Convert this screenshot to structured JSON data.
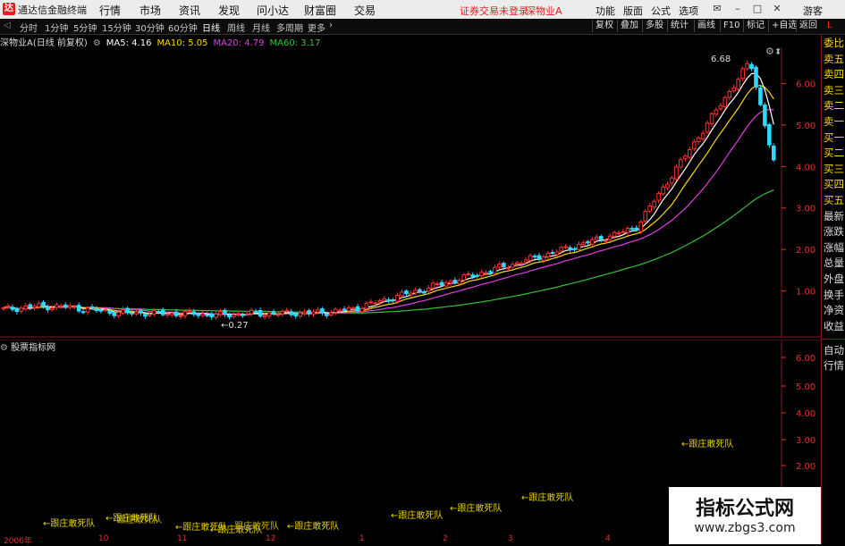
{
  "titlebar": {
    "app_name": "通达信金融终端",
    "menus": [
      "行情",
      "市场",
      "资讯",
      "发现",
      "问小达",
      "财富圈",
      "交易"
    ],
    "notice": "证券交易未登录",
    "stock_name": "深物业A",
    "right_menus": [
      "功能",
      "版面",
      "公式",
      "选项"
    ],
    "user": "游客"
  },
  "toolbar": {
    "periods": [
      "分时",
      "1分钟",
      "5分钟",
      "15分钟",
      "30分钟",
      "60分钟",
      "日线",
      "周线",
      "月线",
      "多周期",
      "更多"
    ],
    "active_period": "日线",
    "right_buttons": [
      "复权",
      "叠加",
      "多股",
      "统计",
      "画线",
      "F10",
      "标记",
      "+自选",
      "返回"
    ]
  },
  "chart_info": {
    "title": "深物业A(日线 前复权)",
    "ma5": "MA5: 4.16",
    "ma10": "MA10: 5.05",
    "ma20": "MA20: 4.79",
    "ma60": "MA60: 3.17",
    "colors": {
      "ma5": "#ffffff",
      "ma10": "#ffd800",
      "ma20": "#e040e0",
      "ma60": "#35c235",
      "up": "#ff3030",
      "down": "#30d8ff"
    }
  },
  "main_chart": {
    "price_labels": [
      "6.00",
      "5.00",
      "4.00",
      "3.00",
      "2.00",
      "1.00"
    ],
    "high_label": "6.68",
    "low_label": "0.27",
    "ylim": [
      0,
      7
    ],
    "indicator_name": "L"
  },
  "right_panel": {
    "items": [
      "委比",
      "卖五",
      "卖四",
      "卖三",
      "卖二",
      "卖一",
      "买一",
      "买二",
      "买三",
      "买四",
      "买五",
      "最新",
      "涨跌",
      "涨幅",
      "总量",
      "外盘",
      "换手",
      "净资",
      "收益"
    ],
    "bottom_items": [
      "自动",
      "行情"
    ]
  },
  "lower_chart": {
    "title": "股票指标网",
    "price_labels": [
      "6.00",
      "5.00",
      "4.00",
      "3.00",
      "2.00"
    ],
    "signal_text": "←跟庄敢死队",
    "signal_text2": "←跟庄敢死队",
    "overlap_text": "跟庄敢死队"
  },
  "x_axis": {
    "labels": [
      "2006年",
      "10",
      "11",
      "12",
      "1",
      "2",
      "3",
      "4"
    ]
  },
  "watermark": {
    "line1": "指标公式网",
    "line2": "www.zbgs3.com"
  }
}
